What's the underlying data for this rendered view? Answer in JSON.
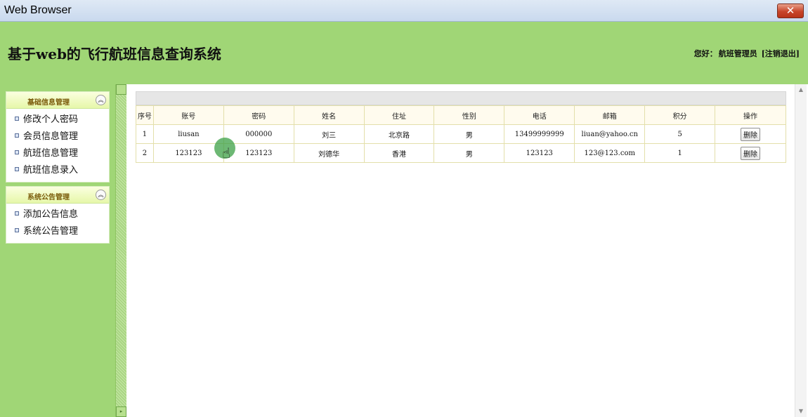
{
  "window": {
    "title": "Web Browser",
    "close_label": "✕"
  },
  "header": {
    "system_title": "基于web的飞行航班信息查询系统",
    "greeting": "您好：",
    "username": "航班管理员",
    "logout": "[注销退出]"
  },
  "sidebar": {
    "panels": [
      {
        "title": "基础信息管理",
        "toggle_icon": "collapse-up-icon",
        "items": [
          "修改个人密码",
          "会员信息管理",
          "航班信息管理",
          "航班信息录入"
        ]
      },
      {
        "title": "系统公告管理",
        "toggle_icon": "collapse-up-icon",
        "items": [
          "添加公告信息",
          "系统公告管理"
        ]
      }
    ]
  },
  "table": {
    "columns": [
      "序号",
      "账号",
      "密码",
      "姓名",
      "住址",
      "性别",
      "电话",
      "邮箱",
      "积分",
      "操作"
    ],
    "rows": [
      [
        "1",
        "liusan",
        "000000",
        "刘三",
        "北京路",
        "男",
        "13499999999",
        "liuan@yahoo.cn",
        "5",
        "删除"
      ],
      [
        "2",
        "123123",
        "123123",
        "刘德华",
        "香港",
        "男",
        "123123",
        "123@123.com",
        "1",
        "删除"
      ]
    ]
  },
  "colors": {
    "header_green": "#a0d676",
    "table_header_bg": "#fffbee",
    "table_border": "#e3dfaa"
  }
}
